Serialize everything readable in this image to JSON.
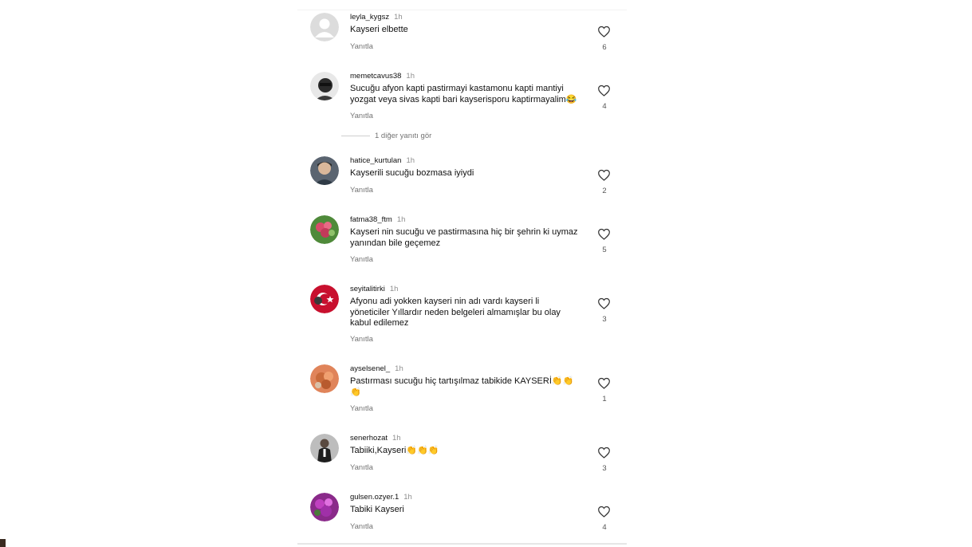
{
  "colors": {
    "text": "#111111",
    "meta": "#8e8e8e",
    "muted": "#737373"
  },
  "more_replies_label": "1 diğer yanıtı gör",
  "comments": [
    {
      "username": "leyla_kygsz",
      "time": "1h",
      "text": "Kayseri elbette",
      "reply": "Yanıtla",
      "likes": "6"
    },
    {
      "username": "memetcavus38",
      "time": "1h",
      "text": "Sucuğu afyon kapti pastirmayi kastamonu kapti mantiyi\nyozgat veya sivas kapti bari kayserisporu kaptirmayalim😂",
      "reply": "Yanıtla",
      "likes": "4"
    },
    {
      "username": "hatice_kurtulan",
      "time": "1h",
      "text": "Kayserili sucuğu bozmasa iyiydi",
      "reply": "Yanıtla",
      "likes": "2"
    },
    {
      "username": "fatma38_ftm",
      "time": "1h",
      "text": "Kayseri nin sucuğu ve pastirmasına hiç bir şehrin ki uymaz\nyanından bile geçemez",
      "reply": "Yanıtla",
      "likes": "5"
    },
    {
      "username": "seyitalitirki",
      "time": "1h",
      "text": "Afyonu adi yokken  kayseri nin adı vardı  kayseri li\nyöneticiler Yıllardır  neden belgeleri almamışlar bu olay\nkabul edilemez",
      "reply": "Yanıtla",
      "likes": "3"
    },
    {
      "username": "ayselsenel_",
      "time": "1h",
      "text": "Pastırması  sucuğu hiç tartışılmaz tabikide KAYSERİ👏👏\n👏",
      "reply": "Yanıtla",
      "likes": "1"
    },
    {
      "username": "senerhozat",
      "time": "1h",
      "text": "Tabiiki,Kayseri👏👏👏",
      "reply": "Yanıtla",
      "likes": "3"
    },
    {
      "username": "gulsen.ozyer.1",
      "time": "1h",
      "text": "Tabiki Kayseri",
      "reply": "Yanıtla",
      "likes": "4"
    }
  ]
}
